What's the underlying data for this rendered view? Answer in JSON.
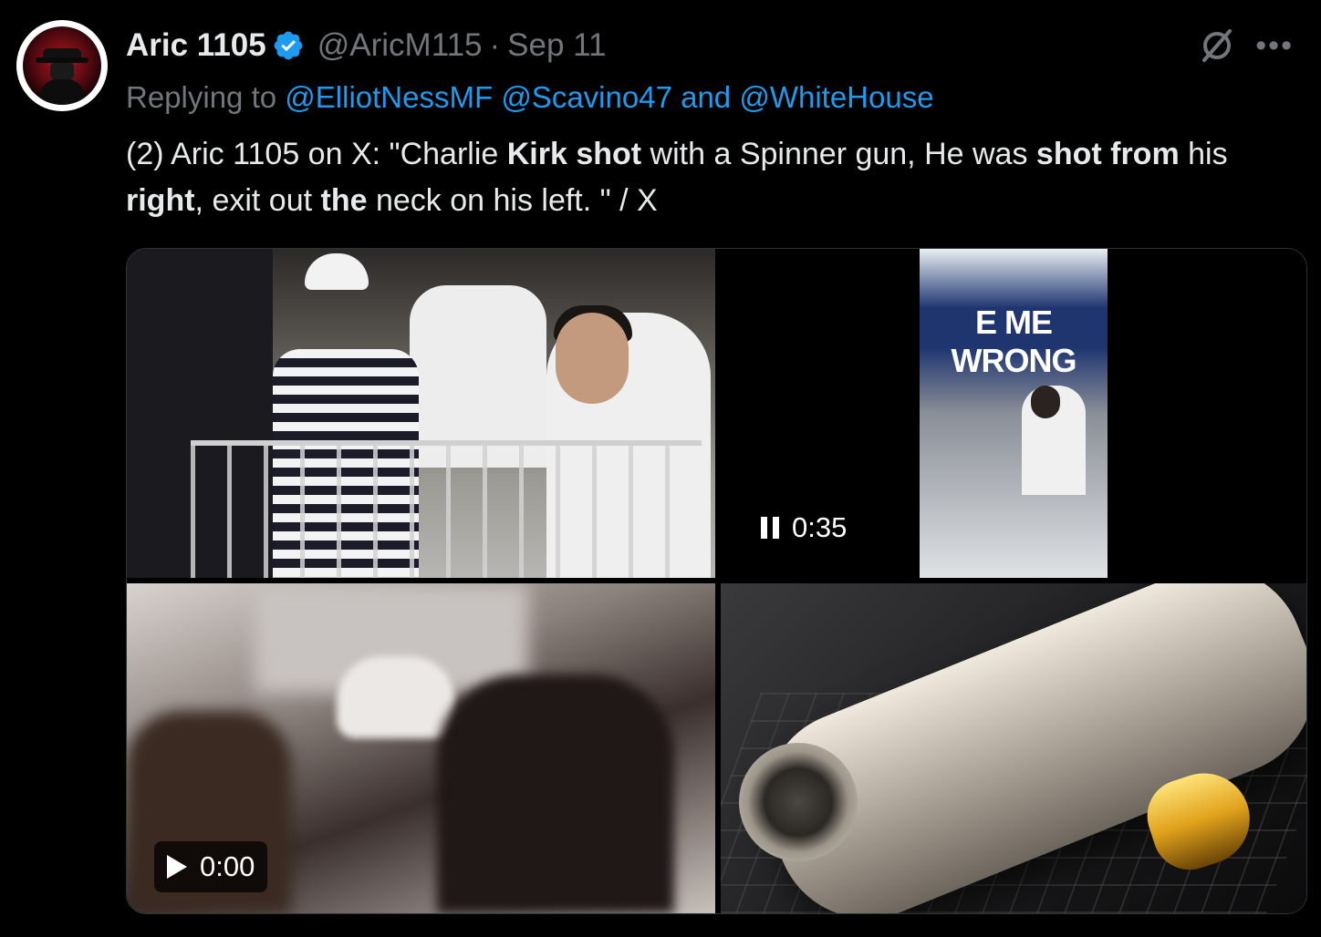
{
  "tweet": {
    "author_name": "Aric 1105",
    "handle": "@AricM115",
    "separator": "·",
    "date": "Sep 11",
    "reply_prefix": "Replying to",
    "reply_user1": "@ElliotNessMF",
    "reply_user2": "@Scavino47",
    "reply_and": "and",
    "reply_user3": "@WhiteHouse",
    "text_segments": [
      {
        "t": "(2) Aric 1105 on X: \"Charlie ",
        "b": false
      },
      {
        "t": "Kirk shot",
        "b": true
      },
      {
        "t": " with a Spinner gun, He was ",
        "b": false
      },
      {
        "t": "shot from",
        "b": true
      },
      {
        "t": " his ",
        "b": false
      },
      {
        "t": "right",
        "b": true
      },
      {
        "t": ", exit out ",
        "b": false
      },
      {
        "t": "the",
        "b": true
      },
      {
        "t": " neck on his left. \" / X",
        "b": false
      }
    ]
  },
  "media": {
    "video1_time": "0:35",
    "video1_banner": "E ME WRONG",
    "video2_time": "0:00"
  },
  "icons": {
    "verified": "verified-badge-icon",
    "grok": "grok-icon",
    "more": "more-icon",
    "pause": "pause-icon",
    "play": "play-icon"
  },
  "colors": {
    "link": "#1d9bf0",
    "secondary_text": "#71767b",
    "primary_text": "#e7e9ea",
    "background": "#000000"
  }
}
